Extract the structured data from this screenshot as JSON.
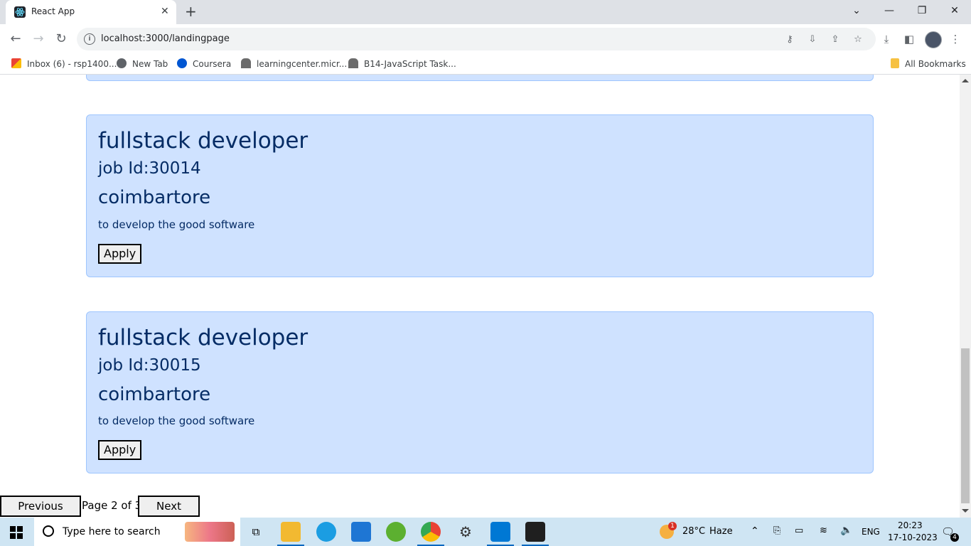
{
  "browser": {
    "tab_title": "React App",
    "tab_close": "✕",
    "new_tab": "+",
    "url": "localhost:3000/landingpage",
    "bookmarks": [
      {
        "label": "Inbox (6) - rsp1400..."
      },
      {
        "label": "New Tab"
      },
      {
        "label": "Coursera"
      },
      {
        "label": "learningcenter.micr..."
      },
      {
        "label": "B14-JavaScript Task..."
      }
    ],
    "all_bookmarks": "All Bookmarks",
    "window_controls": [
      "⌄",
      "—",
      "❐",
      "✕"
    ]
  },
  "jobs": [
    {
      "title": "fullstack developer",
      "job_id": "job Id:30014",
      "location": "coimbartore",
      "description": "to develop the good software",
      "apply_label": "Apply"
    },
    {
      "title": "fullstack developer",
      "job_id": "job Id:30015",
      "location": "coimbartore",
      "description": "to develop the good software",
      "apply_label": "Apply"
    }
  ],
  "pagination": {
    "prev_label": "Previous Page",
    "status": "Page 2 of 3",
    "next_label": "Next Page"
  },
  "taskbar": {
    "search_placeholder": "Type here to search",
    "weather_temp": "28°C",
    "weather_desc": "Haze",
    "weather_badge": "1",
    "language": "ENG",
    "time": "20:23",
    "date": "17-10-2023",
    "notification_count": "4"
  },
  "colors": {
    "card_bg": "#cfe2ff",
    "card_border": "#9ec5fe",
    "card_text": "#052c65",
    "taskbar_bg": "#cfe5f3"
  }
}
